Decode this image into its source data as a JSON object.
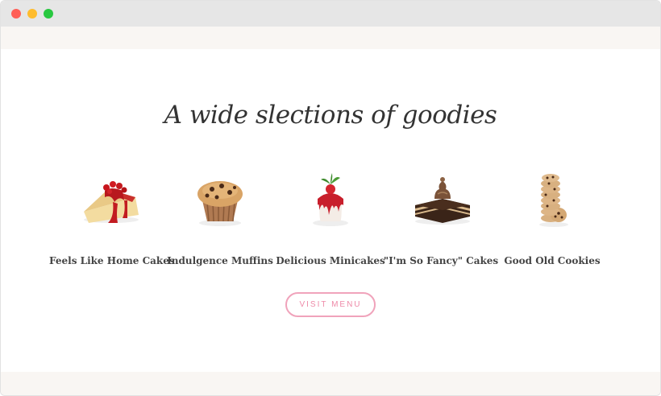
{
  "window": {
    "controls": [
      "close",
      "minimize",
      "zoom"
    ]
  },
  "section": {
    "heading": "A wide slections of goodies",
    "products": [
      {
        "label": "Feels Like Home Cakes",
        "icon": "cheesecake-icon"
      },
      {
        "label": "Indulgence Muffins",
        "icon": "muffin-icon"
      },
      {
        "label": "Delicious Minicakes",
        "icon": "minicake-icon"
      },
      {
        "label": "\"I'm So Fancy\" Cakes",
        "icon": "chocolate-cake-icon"
      },
      {
        "label": "Good Old Cookies",
        "icon": "cookie-stack-icon"
      }
    ],
    "button_label": "VISIT MENU"
  },
  "colors": {
    "accent": "#ee8aa8",
    "band": "#f9f6f3",
    "text": "#444444"
  }
}
